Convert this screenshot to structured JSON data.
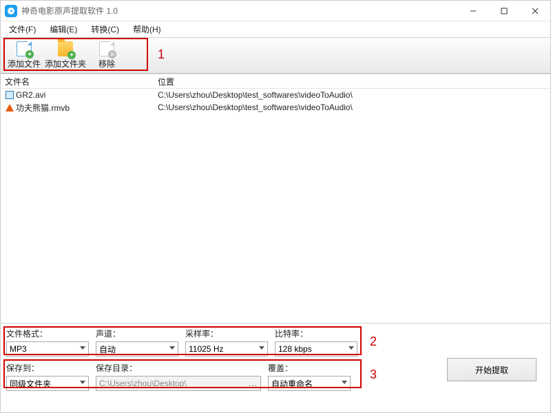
{
  "window": {
    "title": "神奇电影原声提取软件 1.0"
  },
  "menu": {
    "file": "文件(F)",
    "edit": "编辑(E)",
    "convert": "转换(C)",
    "help": "帮助(H)"
  },
  "toolbar": {
    "add_file": "添加文件",
    "add_folder": "添加文件夹",
    "remove": "移除"
  },
  "annot": {
    "n1": "1",
    "n2": "2",
    "n3": "3"
  },
  "columns": {
    "name": "文件名",
    "path": "位置"
  },
  "files": [
    {
      "name": "GR2.avi",
      "path": "C:\\Users\\zhou\\Desktop\\test_softwares\\videoToAudio\\"
    },
    {
      "name": "功夫熊猫.rmvb",
      "path": "C:\\Users\\zhou\\Desktop\\test_softwares\\videoToAudio\\"
    }
  ],
  "labels": {
    "format": "文件格式：",
    "channel": "声道：",
    "samplerate": "采样率：",
    "bitrate": "比特率：",
    "saveto": "保存到：",
    "savedir": "保存目录：",
    "overwrite": "覆盖："
  },
  "values": {
    "format": "MP3",
    "channel": "自动",
    "samplerate": "11025 Hz",
    "bitrate": "128 kbps",
    "saveto": "同级文件夹",
    "savedir": "C:\\Users\\zhou\\Desktop\\",
    "overwrite": "自动重命名"
  },
  "buttons": {
    "start": "开始提取"
  }
}
